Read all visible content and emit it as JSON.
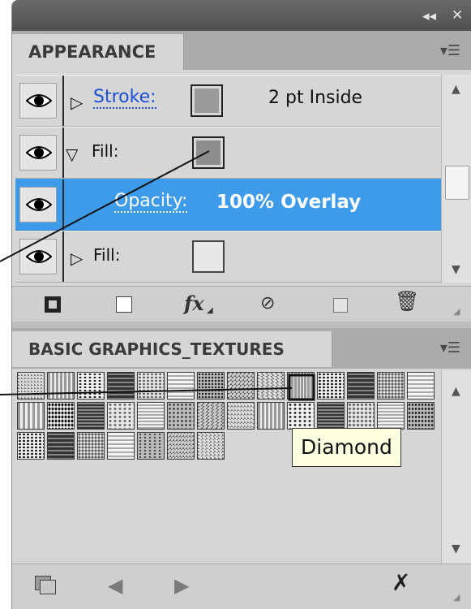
{
  "window_controls": {
    "collapse": "◂◂",
    "close": "✕"
  },
  "appearance": {
    "tab": "APPEARANCE",
    "rows": [
      {
        "label": "Stroke:",
        "value": "2 pt  Inside",
        "swatch_color": "#9a9a9a"
      },
      {
        "label": "Fill:",
        "swatch_color": "#8e8e8e"
      },
      {
        "label": "Opacity:",
        "value": "100% Overlay"
      },
      {
        "label": "Fill:",
        "swatch_color": "#e8e8e8"
      }
    ],
    "toolbar_icons": [
      "add-new-stroke-icon",
      "add-new-fill-icon",
      "fx-icon",
      "clear-appearance-icon",
      "duplicate-item-icon",
      "delete-item-icon"
    ],
    "fx_label": "fx"
  },
  "library": {
    "tab": "BASIC GRAPHICS_TEXTURES",
    "tooltip": "Diamond",
    "swatch_count": 35,
    "toolbar_icons": [
      "swatch-libraries-menu-icon",
      "previous-library-icon",
      "next-library-icon",
      "remove-swatch-icon"
    ]
  },
  "colors": {
    "highlight": "#3d9be9",
    "link": "#1a4fd6",
    "panel": "#d6d6d6",
    "tab_bar": "#ababab"
  }
}
